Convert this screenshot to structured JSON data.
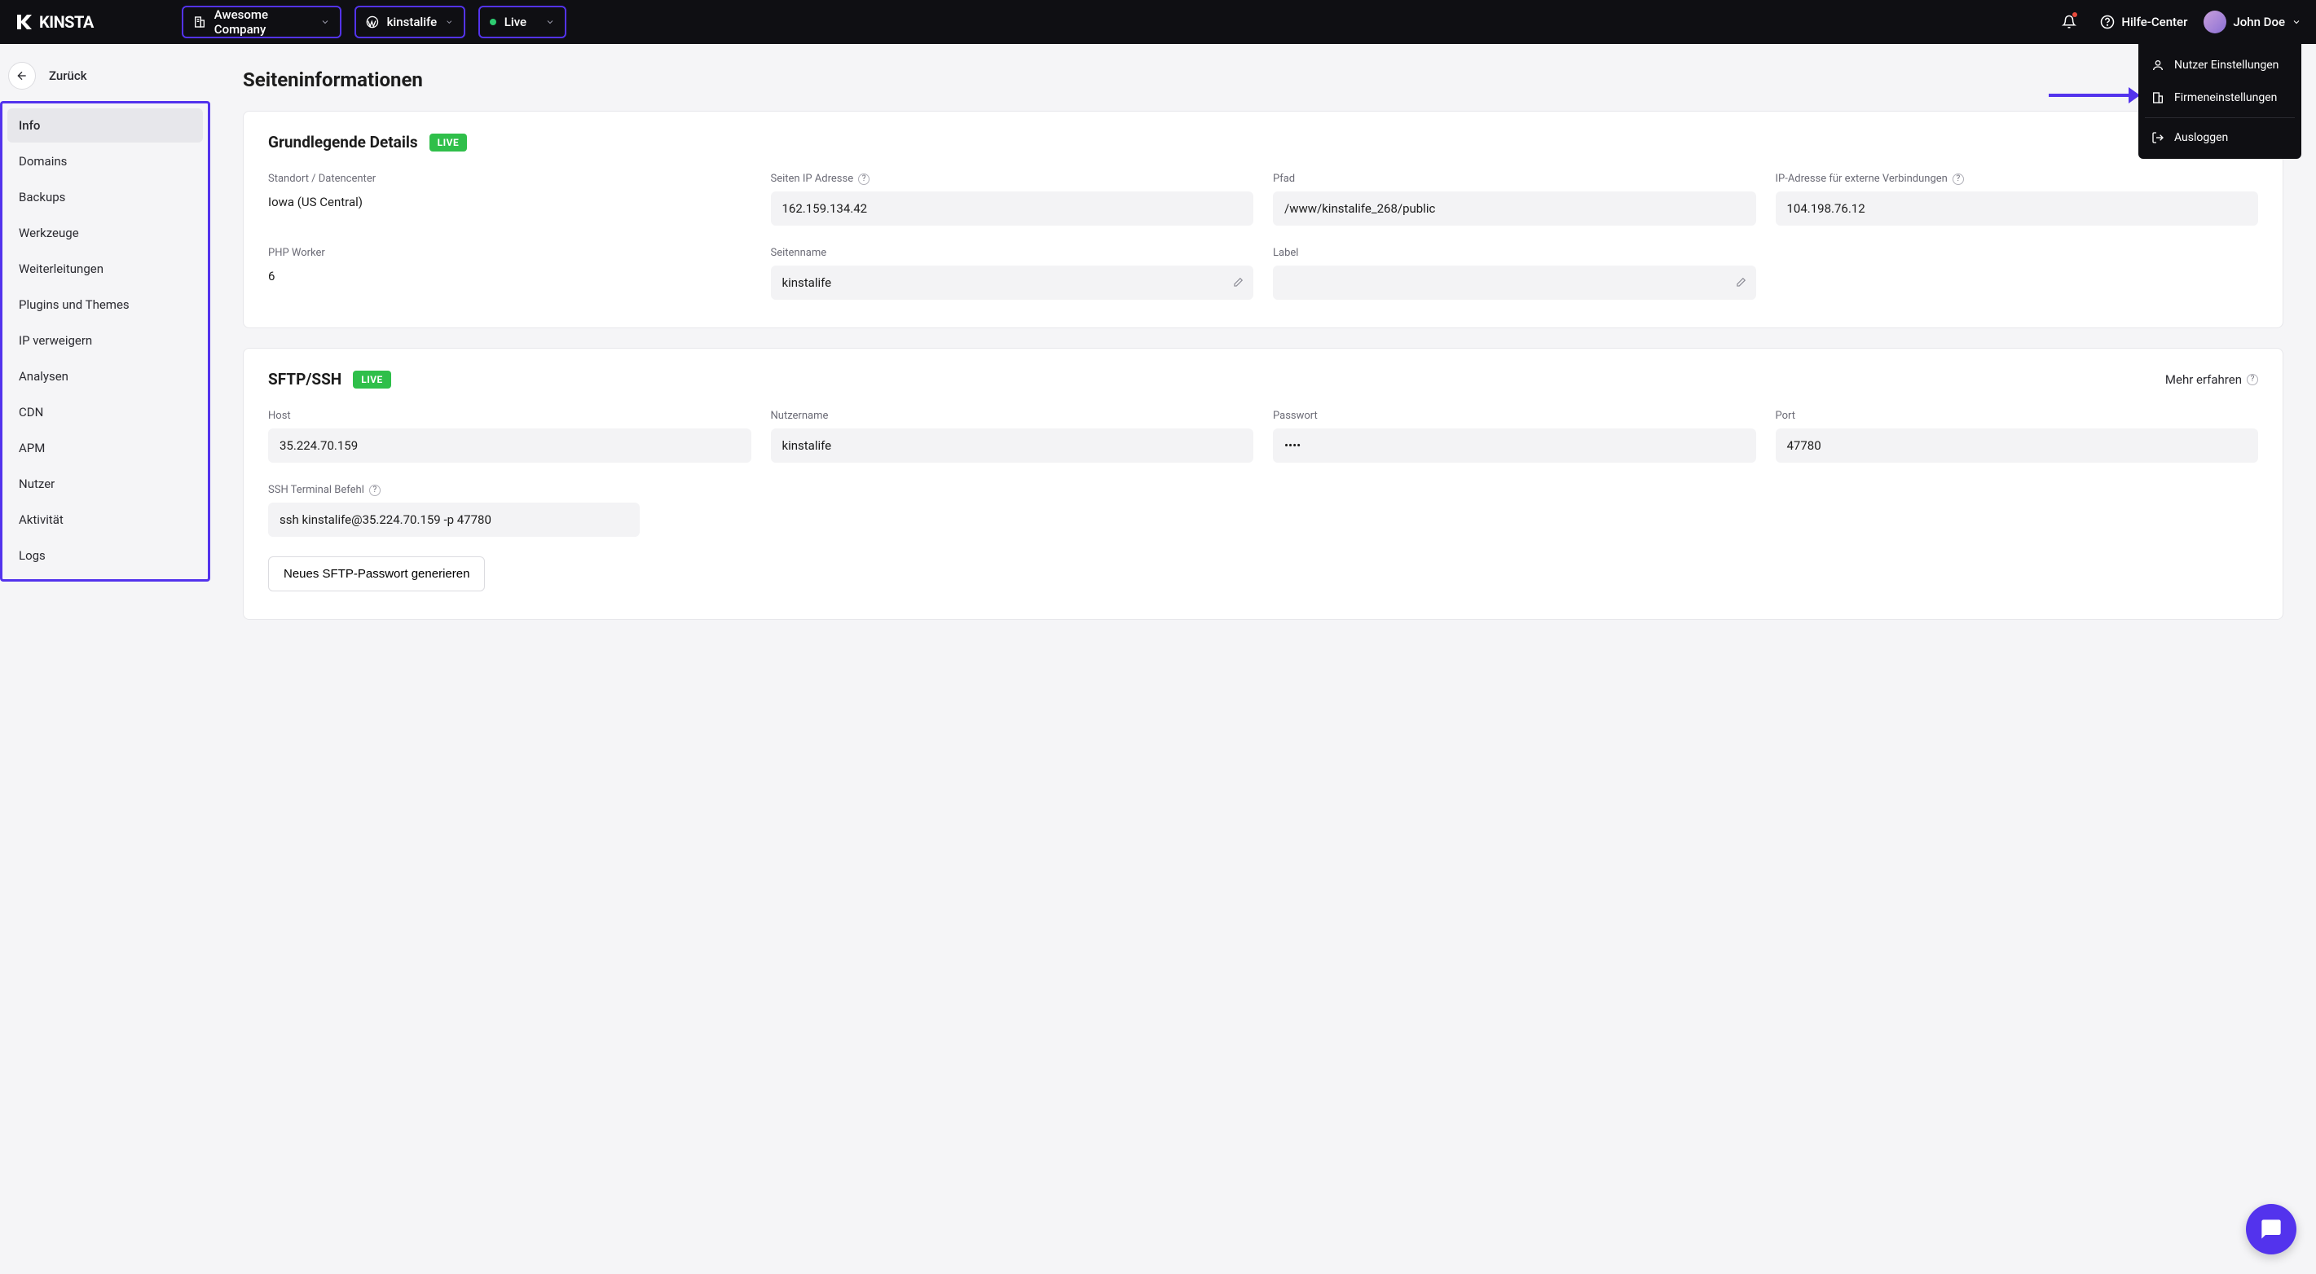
{
  "header": {
    "company": "Awesome Company",
    "site": "kinstalife",
    "env": "Live",
    "help_center": "Hilfe-Center",
    "user_name": "John Doe"
  },
  "dropdown": {
    "user_settings": "Nutzer Einstellungen",
    "company_settings": "Firmeneinstellungen",
    "logout": "Ausloggen"
  },
  "sidebar": {
    "back": "Zurück",
    "items": [
      "Info",
      "Domains",
      "Backups",
      "Werkzeuge",
      "Weiterleitungen",
      "Plugins und Themes",
      "IP verweigern",
      "Analysen",
      "CDN",
      "APM",
      "Nutzer",
      "Aktivität",
      "Logs"
    ]
  },
  "page": {
    "title": "Seiteninformationen"
  },
  "basic": {
    "heading": "Grundlegende Details",
    "badge": "LIVE",
    "location_label": "Standort / Datencenter",
    "location_value": "Iowa (US Central)",
    "ip_label": "Seiten IP Adresse",
    "ip_value": "162.159.134.42",
    "path_label": "Pfad",
    "path_value": "/www/kinstalife_268/public",
    "ext_ip_label": "IP-Adresse für externe Verbindungen",
    "ext_ip_value": "104.198.76.12",
    "php_label": "PHP Worker",
    "php_value": "6",
    "sitename_label": "Seitenname",
    "sitename_value": "kinstalife",
    "label_label": "Label",
    "label_value": ""
  },
  "sftp": {
    "heading": "SFTP/SSH",
    "badge": "LIVE",
    "learn_more": "Mehr erfahren",
    "host_label": "Host",
    "host_value": "35.224.70.159",
    "user_label": "Nutzername",
    "user_value": "kinstalife",
    "pass_label": "Passwort",
    "pass_value": "••••",
    "port_label": "Port",
    "port_value": "47780",
    "ssh_cmd_label": "SSH Terminal Befehl",
    "ssh_cmd_value": "ssh kinstalife@35.224.70.159 -p 47780",
    "gen_btn": "Neues SFTP-Passwort generieren"
  }
}
